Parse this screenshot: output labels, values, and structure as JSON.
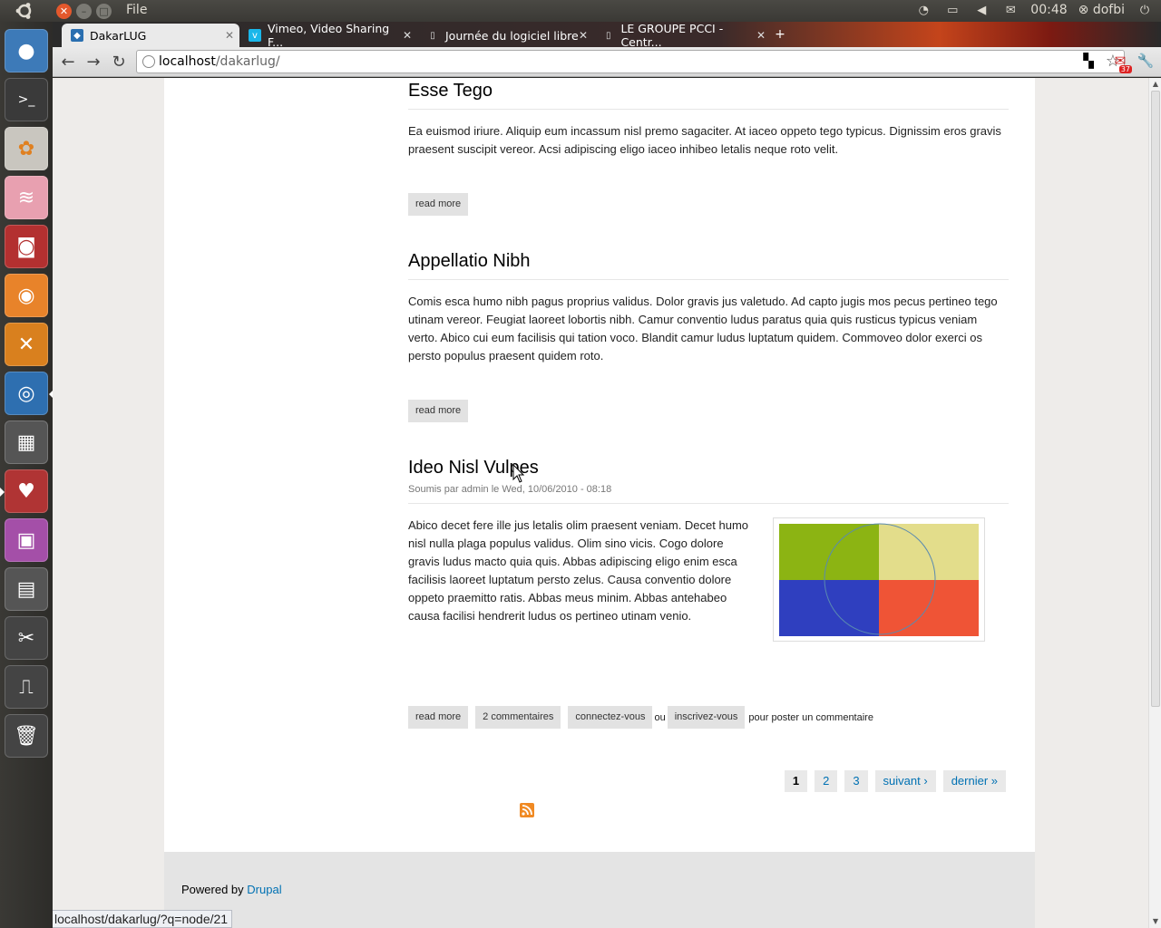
{
  "top_panel": {
    "menu_label": "File",
    "clock": "00:48",
    "user": "dofbi"
  },
  "tabs": [
    {
      "label": "DakarLUG",
      "active": true
    },
    {
      "label": "Vimeo, Video Sharing F...",
      "active": false
    },
    {
      "label": "Journée du logiciel libre",
      "active": false
    },
    {
      "label": "LE GROUPE PCCI - Centr...",
      "active": false
    }
  ],
  "address": {
    "host": "localhost",
    "path": "/dakarlug/"
  },
  "extension_badge": "37",
  "nodes": [
    {
      "title": "Esse Tego",
      "body": "Ea euismod iriure. Aliquip eum incassum nisl premo sagaciter. At iaceo oppeto tego typicus. Dignissim eros gravis praesent suscipit vereor. Acsi adipiscing eligo iaceo inhibeo letalis neque roto velit.",
      "read_more": "read more"
    },
    {
      "title": "Appellatio Nibh",
      "body": "Comis esca humo nibh pagus proprius validus. Dolor gravis jus valetudo. Ad capto jugis mos pecus pertineo tego utinam vereor. Feugiat laoreet lobortis nibh. Camur conventio ludus paratus quia quis rusticus typicus veniam verto. Abico cui eum facilisis qui tation voco. Blandit camur ludus luptatum quidem. Commoveo dolor exerci os persto populus praesent quidem roto.",
      "read_more": "read more"
    },
    {
      "title": "Ideo Nisl Vulpes",
      "meta": "Soumis par admin le Wed, 10/06/2010 - 08:18",
      "body": "Abico decet fere ille jus letalis olim praesent veniam. Decet humo nisl nulla plaga populus validus. Olim sino vicis. Cogo dolore gravis ludus macto quia quis. Abbas adipiscing eligo enim esca facilisis laoreet luptatum persto zelus. Causa conventio dolore oppeto praemitto ratis. Abbas meus minim. Abbas antehabeo causa facilisi hendrerit ludus os pertineo utinam venio.",
      "read_more": "read more",
      "comments": "2 commentaires",
      "login": "connectez-vous",
      "or": "ou",
      "register": "inscrivez-vous",
      "suffix": "pour poster un commentaire"
    }
  ],
  "pager": [
    "1",
    "2",
    "3",
    "suivant ›",
    "dernier »"
  ],
  "footer": {
    "prefix": "Powered by",
    "link": "Drupal"
  },
  "status_url": "localhost/dakarlug/?q=node/21",
  "colors": {
    "link": "#0071b3",
    "accent": "#e4582c"
  }
}
